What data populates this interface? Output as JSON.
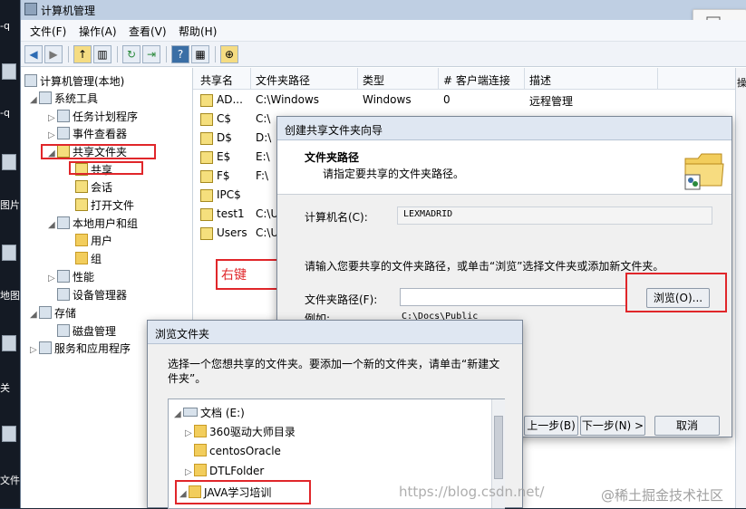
{
  "window": {
    "title": "计算机管理"
  },
  "menu": [
    "文件(F)",
    "操作(A)",
    "查看(V)",
    "帮助(H)"
  ],
  "toolbar_icons": [
    "back-arrow-icon",
    "forward-arrow-icon",
    "up-folder-icon",
    "show-hide-tree-icon",
    "refresh-icon",
    "export-icon",
    "help-icon",
    "properties-icon",
    "share-icon"
  ],
  "tree": {
    "root": "计算机管理(本地)",
    "system_tools": "系统工具",
    "task_scheduler": "任务计划程序",
    "event_viewer": "事件查看器",
    "shared_folders": "共享文件夹",
    "shares": "共享",
    "sessions": "会话",
    "open_files": "打开文件",
    "local_users": "本地用户和组",
    "users": "用户",
    "groups": "组",
    "performance": "性能",
    "device_manager": "设备管理器",
    "storage": "存储",
    "disk_management": "磁盘管理",
    "services_apps": "服务和应用程序"
  },
  "annotation_right_click": "右键",
  "shares_table": {
    "columns": [
      "共享名",
      "文件夹路径",
      "类型",
      "# 客户端连接",
      "描述"
    ],
    "rows": [
      [
        "AD...",
        "C:\\Windows",
        "Windows",
        "0",
        "远程管理"
      ],
      [
        "C$",
        "C:\\",
        "",
        "",
        ""
      ],
      [
        "D$",
        "D:\\",
        "",
        "",
        ""
      ],
      [
        "E$",
        "E:\\",
        "",
        "",
        ""
      ],
      [
        "F$",
        "F:\\",
        "",
        "",
        ""
      ],
      [
        "IPC$",
        "",
        "",
        "",
        ""
      ],
      [
        "test1",
        "C:\\U",
        "",
        "",
        ""
      ],
      [
        "Users",
        "C:\\U",
        "",
        "",
        ""
      ]
    ]
  },
  "actions_label": "操作",
  "wizard": {
    "title": "创建共享文件夹向导",
    "header_title": "文件夹路径",
    "header_subtitle": "请指定要共享的文件夹路径。",
    "computer_name_label": "计算机名(C):",
    "computer_name_value": "LEXMADRID",
    "instructions": "请输入您要共享的文件夹路径，或单击“浏览”选择文件夹或添加新文件夹。",
    "folder_path_label": "文件夹路径(F):",
    "folder_path_value": "",
    "browse_button": "浏览(O)...",
    "example_label": "例如:",
    "example_value": "C:\\Docs\\Public",
    "back_button": "上一步(B)",
    "next_button": "下一步(N) >",
    "cancel_button": "取消"
  },
  "browse_dialog": {
    "title": "浏览文件夹",
    "instructions": "选择一个您想共享的文件夹。要添加一个新的文件夹，请单击“新建文件夹”。",
    "drive": "文档 (E:)",
    "folders": [
      "360驱动大师目录",
      "centosOracle",
      "DTLFolder",
      "JAVA学习培训"
    ]
  },
  "watermark": {
    "url": "https://blog.csdn.net/",
    "brand": "@稀土掘金技术社区"
  },
  "desktop_labels": [
    "-q",
    "-q",
    "图片",
    "地图",
    "关",
    "文件"
  ],
  "colors": {
    "highlight": "#e0262a",
    "accent": "#3a6ea5"
  }
}
